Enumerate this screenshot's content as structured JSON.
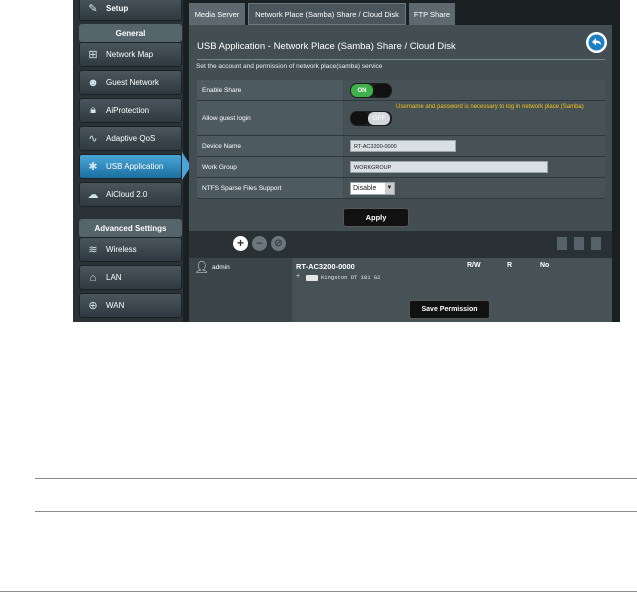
{
  "sidebar": {
    "setup": "Setup",
    "general_heading": "General",
    "general_items": [
      {
        "label": "Network Map",
        "icon": "network-map-icon"
      },
      {
        "label": "Guest Network",
        "icon": "guest-network-icon"
      },
      {
        "label": "AiProtection",
        "icon": "lock-icon"
      },
      {
        "label": "Adaptive QoS",
        "icon": "qos-icon"
      },
      {
        "label": "USB Application",
        "icon": "puzzle-icon"
      },
      {
        "label": "AiCloud 2.0",
        "icon": "cloud-icon"
      }
    ],
    "advanced_heading": "Advanced Settings",
    "advanced_items": [
      {
        "label": "Wireless",
        "icon": "wifi-icon"
      },
      {
        "label": "LAN",
        "icon": "home-icon"
      },
      {
        "label": "WAN",
        "icon": "globe-icon"
      }
    ]
  },
  "tabs": [
    "Media Server",
    "Network Place (Samba) Share / Cloud Disk",
    "FTP Share"
  ],
  "page": {
    "title": "USB Application - Network Place (Samba) Share / Cloud Disk",
    "description": "Set the account and permission of network place(samba) service"
  },
  "settings": {
    "enable_share_label": "Enable Share",
    "enable_share_state": "ON",
    "guest_login_label": "Allow guest login",
    "guest_login_state": "OFF",
    "guest_login_warning": "Username and password is necessary to log in network place (Samba)",
    "device_name_label": "Device Name",
    "device_name_value": "RT-AC3200-0000",
    "work_group_label": "Work Group",
    "work_group_value": "WORKGROUP",
    "ntfs_label": "NTFS Sparse Files Support",
    "ntfs_value": "Disable"
  },
  "apply_label": "Apply",
  "accounts": {
    "user": "admin",
    "device": "RT-AC3200-0000",
    "perm_headers": [
      "R/W",
      "R",
      "No"
    ],
    "disk_label": "Kingston DT 101 G2",
    "save_label": "Save Permission"
  },
  "colors": {
    "accent": "#4aa6d8",
    "toggle_on": "#3fb14b",
    "warning": "#f0c419"
  }
}
